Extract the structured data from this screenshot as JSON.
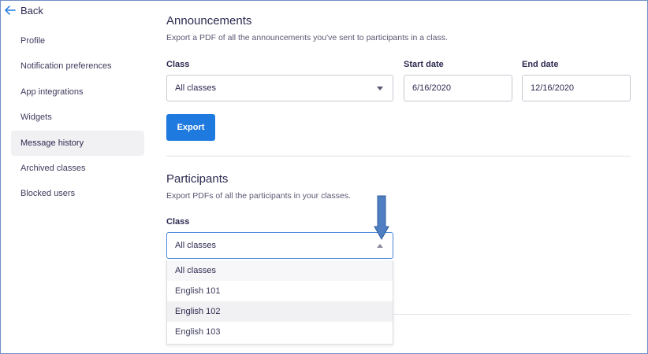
{
  "nav": {
    "back_label": "Back",
    "items": [
      {
        "label": "Profile"
      },
      {
        "label": "Notification preferences"
      },
      {
        "label": "App integrations"
      },
      {
        "label": "Widgets"
      },
      {
        "label": "Message history",
        "active": true
      },
      {
        "label": "Archived classes"
      },
      {
        "label": "Blocked users"
      }
    ]
  },
  "announcements": {
    "title": "Announcements",
    "description": "Export a PDF of all the announcements you've sent to participants in a class.",
    "class_label": "Class",
    "class_value": "All classes",
    "start_label": "Start date",
    "start_value": "6/16/2020",
    "end_label": "End date",
    "end_value": "12/16/2020",
    "export_label": "Export"
  },
  "participants": {
    "title": "Participants",
    "description": "Export PDFs of all the participants in your classes.",
    "class_label": "Class",
    "class_value": "All classes",
    "dropdown_open": true,
    "options": [
      {
        "label": "All classes",
        "selected": true
      },
      {
        "label": "English 101"
      },
      {
        "label": "English 102",
        "hovered": true
      },
      {
        "label": "English 103"
      }
    ]
  },
  "colors": {
    "accent": "#1f7ae0",
    "annotation_arrow": "#4f7ec2"
  }
}
